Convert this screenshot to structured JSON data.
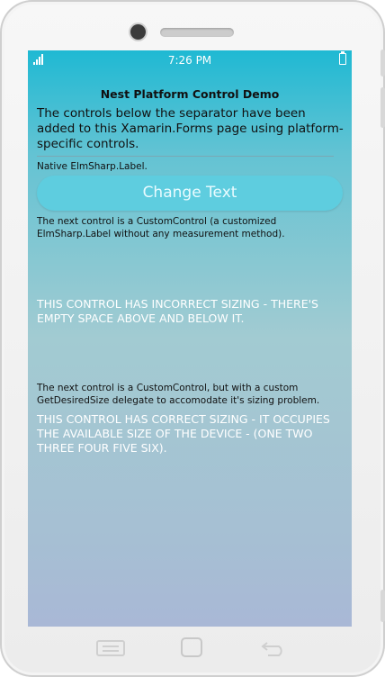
{
  "statusbar": {
    "time": "7:26 PM",
    "icons": [
      "signal-icon",
      "battery-icon"
    ]
  },
  "page": {
    "title": "Nest Platform Control Demo",
    "description": "The controls below the separator have been added to this Xamarin.Forms page using platform-specific controls.",
    "native_label": "Native ElmSharp.Label.",
    "change_button_label": "Change Text",
    "note_custom_control": "The next control is a CustomControl (a customized ElmSharp.Label without any measurement method).",
    "incorrect_sizing_text": "THIS CONTROL HAS INCORRECT SIZING - THERE'S EMPTY SPACE ABOVE AND BELOW IT.",
    "note_custom_control_sized": "The next control is a CustomControl, but with a custom GetDesiredSize delegate to accomodate it's sizing problem.",
    "correct_sizing_text": "THIS CONTROL HAS CORRECT SIZING - IT OCCUPIES THE AVAILABLE SIZE OF THE DEVICE - (ONE TWO THREE FOUR FIVE SIX)."
  },
  "hardware_keys": [
    "menu-icon",
    "home-icon",
    "back-icon"
  ],
  "colors": {
    "accent": "#1fb9d3",
    "button": "#5ecddf",
    "screen_bottom": "#a9b8d6"
  }
}
